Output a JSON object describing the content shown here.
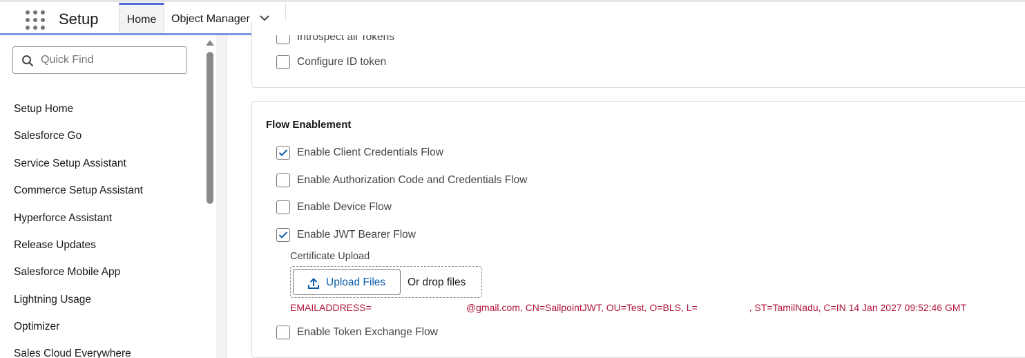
{
  "header": {
    "app_name": "Setup",
    "tabs": [
      {
        "label": "Home",
        "active": true
      },
      {
        "label": "Object Manager",
        "active": false
      }
    ],
    "accent_color": "#8093e3"
  },
  "sidebar": {
    "search": {
      "placeholder": "Quick Find",
      "value": ""
    },
    "items": [
      {
        "label": "Setup Home"
      },
      {
        "label": "Salesforce Go"
      },
      {
        "label": "Service Setup Assistant"
      },
      {
        "label": "Commerce Setup Assistant"
      },
      {
        "label": "Hyperforce Assistant"
      },
      {
        "label": "Release Updates"
      },
      {
        "label": "Salesforce Mobile App"
      },
      {
        "label": "Lightning Usage"
      },
      {
        "label": "Optimizer"
      },
      {
        "label": "Sales Cloud Everywhere"
      }
    ]
  },
  "main": {
    "top_section": {
      "options": [
        {
          "label": "Introspect all Tokens",
          "checked": false
        },
        {
          "label": "Configure ID token",
          "checked": false
        }
      ]
    },
    "flow_section": {
      "title": "Flow Enablement",
      "options": [
        {
          "label": "Enable Client Credentials Flow",
          "checked": true
        },
        {
          "label": "Enable Authorization Code and Credentials Flow",
          "checked": false
        },
        {
          "label": "Enable Device Flow",
          "checked": false
        },
        {
          "label": "Enable JWT Bearer Flow",
          "checked": true
        },
        {
          "label": "Enable Token Exchange Flow",
          "checked": false
        }
      ],
      "certificate": {
        "label": "Certificate Upload",
        "upload_button": "Upload Files",
        "drop_text": "Or drop files",
        "info_part1": "EMAILADDRESS=",
        "info_part2": "@gmail.com, CN=SailpointJWT, OU=Test, O=BLS, L=",
        "info_part3": ", ST=TamilNadu, C=IN 14 Jan 2027 09:52:46 GMT",
        "info_color": "#b0143c"
      }
    }
  }
}
